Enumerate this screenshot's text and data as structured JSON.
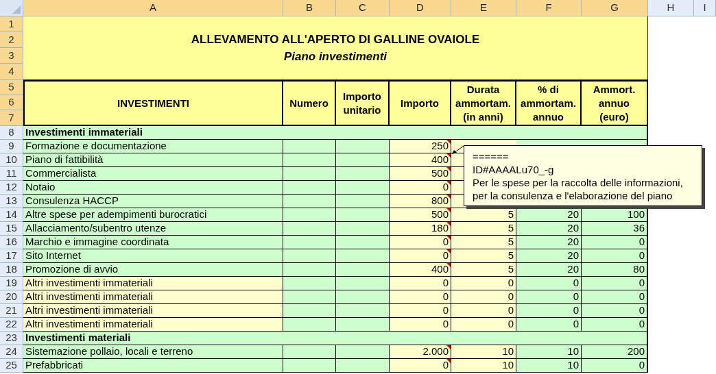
{
  "columns": [
    {
      "label": "A",
      "selected": true
    },
    {
      "label": "B",
      "selected": true
    },
    {
      "label": "C",
      "selected": true
    },
    {
      "label": "D",
      "selected": true
    },
    {
      "label": "E",
      "selected": true
    },
    {
      "label": "F",
      "selected": true
    },
    {
      "label": "G",
      "selected": true
    },
    {
      "label": "H",
      "selected": false
    },
    {
      "label": "I",
      "selected": false
    }
  ],
  "title_rows": [
    {
      "num": "1",
      "selected": true
    },
    {
      "num": "2",
      "selected": true
    },
    {
      "num": "3",
      "selected": true
    },
    {
      "num": "4",
      "selected": true
    }
  ],
  "title": "ALLEVAMENTO ALL'APERTO DI GALLINE OVAIOLE",
  "subtitle": "Piano investimenti",
  "header_rows": [
    {
      "num": "5",
      "selected": true
    },
    {
      "num": "6",
      "selected": true
    },
    {
      "num": "7",
      "selected": true
    }
  ],
  "headers": [
    "INVESTIMENTI",
    "Numero",
    "Importo unitario",
    "Importo",
    "Durata ammortam. (in anni)",
    "% di ammortam. annuo",
    "Ammort. annuo (euro)"
  ],
  "rows": [
    {
      "num": "8",
      "kind": "section",
      "label": "Investimenti immateriali"
    },
    {
      "num": "9",
      "kind": "item",
      "label": "Formazione e documentazione",
      "editable": false,
      "importo": "250",
      "has_comment": true
    },
    {
      "num": "10",
      "kind": "item",
      "label": "Piano di fattibilità",
      "editable": false,
      "importo": "400",
      "has_comment": true
    },
    {
      "num": "11",
      "kind": "item",
      "label": "Commercialista",
      "editable": false,
      "importo": "500",
      "has_comment": true
    },
    {
      "num": "12",
      "kind": "item",
      "label": "Notaio",
      "editable": false,
      "importo": "0",
      "has_comment": true
    },
    {
      "num": "13",
      "kind": "item",
      "label": "Consulenza HACCP",
      "editable": false,
      "importo": "800",
      "has_comment": true
    },
    {
      "num": "14",
      "kind": "item",
      "label": "Altre spese per adempimenti burocratici",
      "editable": false,
      "importo": "500",
      "has_comment": true,
      "durata": "5",
      "percent": "20",
      "ammort": "100"
    },
    {
      "num": "15",
      "kind": "item",
      "label": "Allacciamento/subentro utenze",
      "editable": false,
      "importo": "180",
      "has_comment": true,
      "durata": "5",
      "percent": "20",
      "ammort": "36"
    },
    {
      "num": "16",
      "kind": "item",
      "label": "Marchio e immagine coordinata",
      "editable": false,
      "importo": "0",
      "has_comment": true,
      "durata": "5",
      "percent": "20",
      "ammort": "0"
    },
    {
      "num": "17",
      "kind": "item",
      "label": "Sito Internet",
      "editable": false,
      "importo": "0",
      "has_comment": true,
      "durata": "5",
      "percent": "20",
      "ammort": "0"
    },
    {
      "num": "18",
      "kind": "item",
      "label": "Promozione di avvio",
      "editable": false,
      "importo": "400",
      "has_comment": true,
      "durata": "5",
      "percent": "20",
      "ammort": "80"
    },
    {
      "num": "19",
      "kind": "item",
      "label": "Altri investimenti immateriali",
      "editable": true,
      "importo": "0",
      "has_comment": false,
      "durata": "0",
      "percent": "0",
      "ammort": "0"
    },
    {
      "num": "20",
      "kind": "item",
      "label": "Altri investimenti immateriali",
      "editable": true,
      "importo": "0",
      "has_comment": false,
      "durata": "0",
      "percent": "0",
      "ammort": "0"
    },
    {
      "num": "21",
      "kind": "item",
      "label": "Altri investimenti immateriali",
      "editable": true,
      "importo": "0",
      "has_comment": false,
      "durata": "0",
      "percent": "0",
      "ammort": "0"
    },
    {
      "num": "22",
      "kind": "item",
      "label": "Altri investimenti immateriali",
      "editable": true,
      "importo": "0",
      "has_comment": false,
      "durata": "0",
      "percent": "0",
      "ammort": "0"
    },
    {
      "num": "23",
      "kind": "section",
      "label": "Investimenti materiali"
    },
    {
      "num": "24",
      "kind": "item",
      "label": "Sistemazione pollaio, locali e terreno",
      "editable": false,
      "importo": "2.000",
      "has_comment": true,
      "durata": "10",
      "percent": "10",
      "ammort": "200"
    },
    {
      "num": "25",
      "kind": "item",
      "label": "Prefabbricati",
      "editable": false,
      "importo": "0",
      "has_comment": true,
      "durata": "10",
      "percent": "10",
      "ammort": "0"
    }
  ],
  "comment": {
    "lines": [
      "======",
      "ID#AAAALu70_-g",
      "Per le spese per la raccolta delle informazioni,",
      "per la consulenza e l'elaborazione del piano"
    ]
  }
}
